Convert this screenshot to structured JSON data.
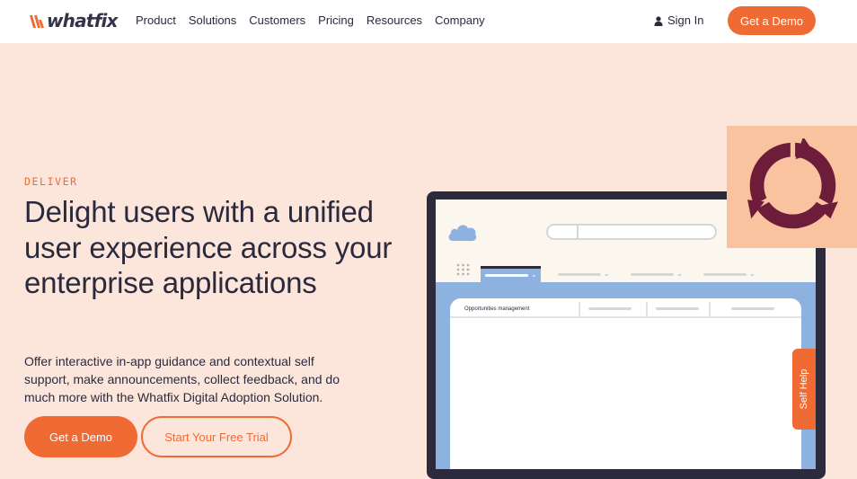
{
  "nav": {
    "logo_text": "whatfix",
    "items": [
      {
        "label": "Product"
      },
      {
        "label": "Solutions"
      },
      {
        "label": "Customers"
      },
      {
        "label": "Pricing"
      },
      {
        "label": "Resources"
      },
      {
        "label": "Company"
      }
    ],
    "sign_in": "Sign In",
    "demo_button": "Get a Demo"
  },
  "hero": {
    "eyebrow": "DELIVER",
    "headline": "Delight users with a unified user experience across your enterprise applications",
    "subtext": "Offer interactive in-app guidance and contextual self support, make announcements, collect feedback, and do much more with the Whatfix Digital Adoption Solution.",
    "primary_button": "Get a Demo",
    "secondary_button": "Start Your Free Trial"
  },
  "mock": {
    "panel_title": "Opportunities management",
    "icons": [
      "cloud-icon",
      "grid-dots-icon",
      "chevron-down-icon",
      "cycle-arrows-icon"
    ]
  },
  "self_help": "Self Help",
  "colors": {
    "accent": "#f06b34",
    "background": "#fce6dc",
    "text": "#2b2a3d",
    "device_frame": "#2c2b3e",
    "screen_blue": "#8eb2df",
    "cycle_card": "#f9c39f",
    "cycle_icon": "#6d1d3a"
  }
}
